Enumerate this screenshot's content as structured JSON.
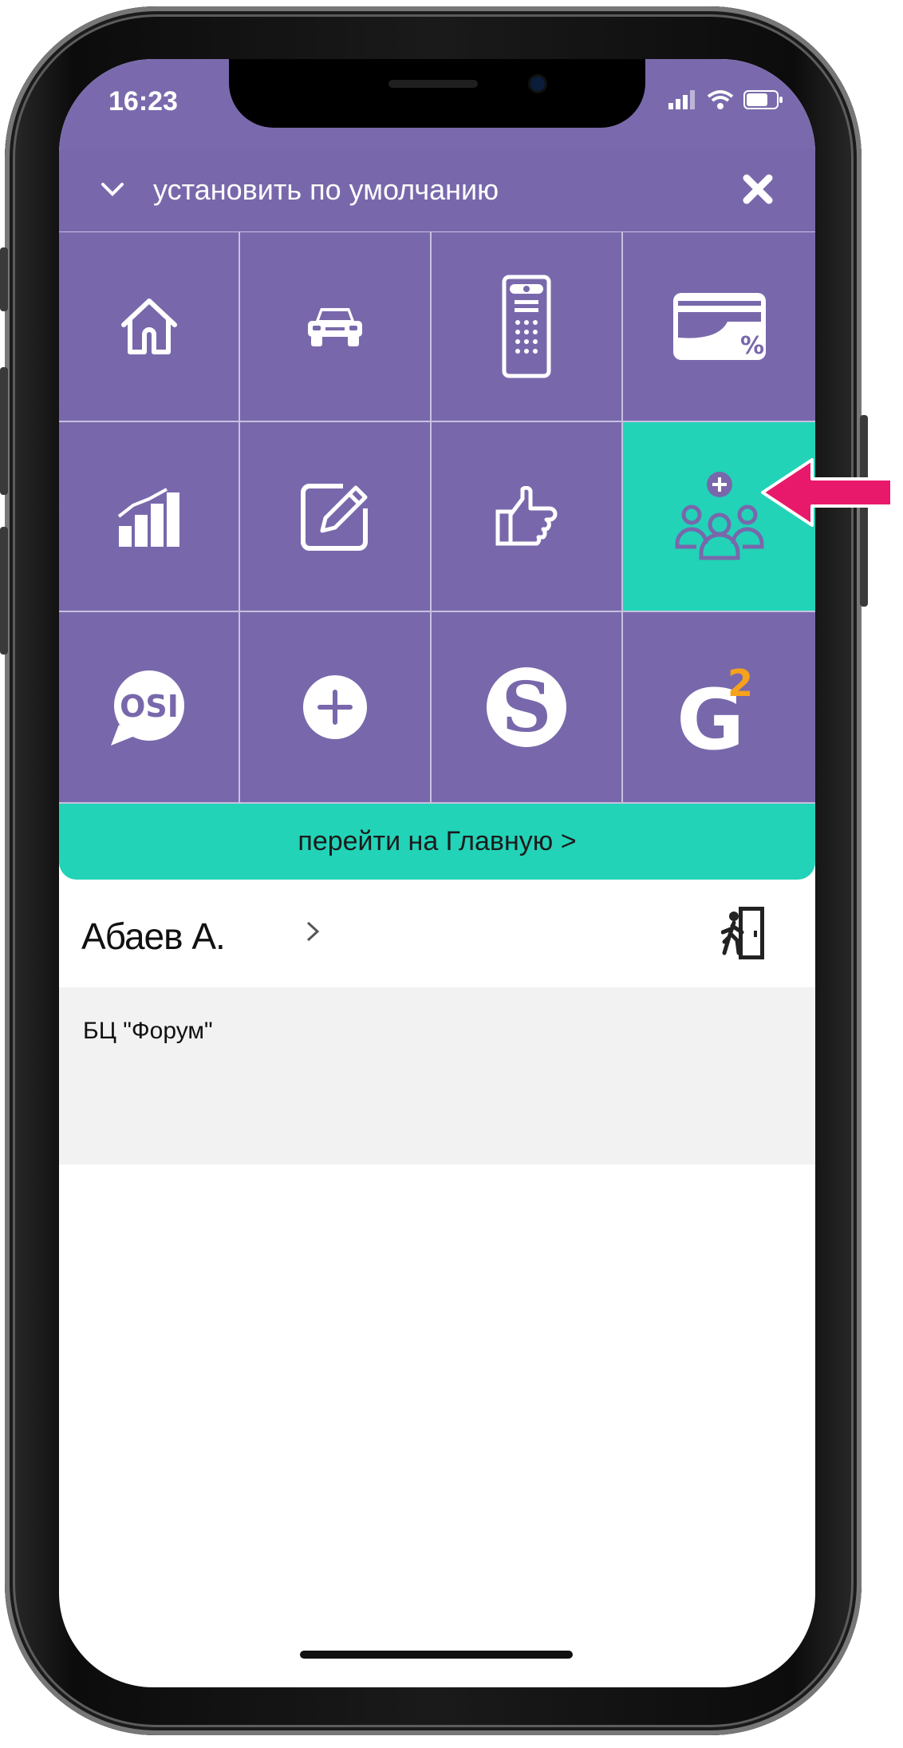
{
  "status_bar": {
    "time": "16:23"
  },
  "header": {
    "title": "установить по умолчанию"
  },
  "tiles": [
    {
      "icon": "home-icon"
    },
    {
      "icon": "car-icon"
    },
    {
      "icon": "intercom-icon"
    },
    {
      "icon": "discount-card-icon"
    },
    {
      "icon": "chart-icon"
    },
    {
      "icon": "edit-icon"
    },
    {
      "icon": "thumbs-up-icon"
    },
    {
      "icon": "add-group-icon",
      "active": true
    },
    {
      "icon": "osi-icon",
      "text": "OSI"
    },
    {
      "icon": "plus-circle-icon"
    },
    {
      "icon": "s-logo-icon",
      "text": "S"
    },
    {
      "icon": "g2-logo-icon",
      "text": "G",
      "superscript": "2"
    }
  ],
  "goto": {
    "label": "перейти на Главную >"
  },
  "user": {
    "name": "Абаев А."
  },
  "org": {
    "name": "БЦ \"Форум\""
  },
  "colors": {
    "primary": "#7868ab",
    "accent": "#22d3b8",
    "arrow": "#e8196b"
  }
}
